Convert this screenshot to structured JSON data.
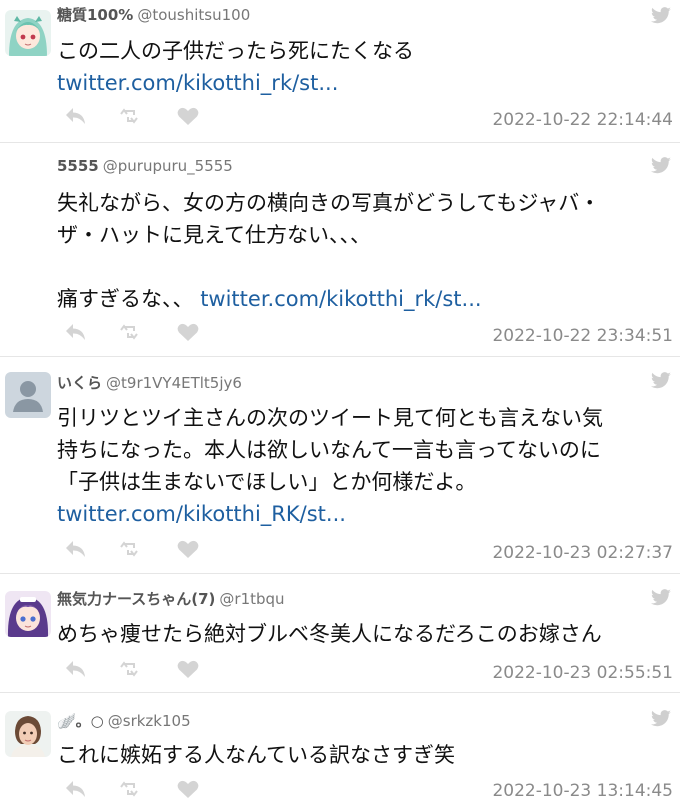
{
  "tweets": [
    {
      "name": "糖質100%",
      "handle": "@toushitsu100",
      "lines": [
        "この二人の子供だったら死にたくなる"
      ],
      "link": "twitter.com/kikotthi_rk/st...",
      "time": "2022-10-22 22:14:44",
      "avatar": "anime-girl-green-hair"
    },
    {
      "name": "5555",
      "handle": "@purupuru_5555",
      "lines": [
        "失礼ながら、女の方の横向きの写真がどうしてもジャバ・",
        "ザ・ハットに見えて仕方ない、、、",
        "",
        "痛すぎるな、、 "
      ],
      "link": "twitter.com/kikotthi_rk/st...",
      "time": "2022-10-22 23:34:51",
      "avatar": "none"
    },
    {
      "name": "いくら",
      "handle": "@t9r1VY4ETlt5jy6",
      "lines": [
        "引リツとツイ主さんの次のツイート見て何とも言えない気",
        "持ちになった。本人は欲しいなんて一言も言ってないのに",
        "「子供は生まないでほしい」とか何様だよ。"
      ],
      "link": "twitter.com/kikotthi_RK/st...",
      "time": "2022-10-23 02:27:37",
      "avatar": "default-profile"
    },
    {
      "name": "無気力ナースちゃん(7)",
      "handle": "@r1tbqu",
      "lines": [
        "めちゃ痩せたら絶対ブルベ冬美人になるだろこのお嫁さん"
      ],
      "link": "",
      "time": "2022-10-23 02:55:51",
      "avatar": "anime-girl-purple-hair"
    },
    {
      "name": "🪽。○",
      "handle": "@srkzk105",
      "lines": [
        "これに嫉妬する人なんている訳なさすぎ笑"
      ],
      "link": "",
      "time": "2022-10-23 13:14:45",
      "avatar": "photo-person"
    }
  ],
  "icons": {
    "reply": "reply-icon",
    "retweet": "retweet-icon",
    "like": "heart-icon",
    "brand": "twitter-bird-icon"
  },
  "colors": {
    "link": "#1e5fa0",
    "timestamp": "#8a8a8a",
    "action_icons": "#d4d4d4",
    "bird": "#cfcfcf"
  }
}
